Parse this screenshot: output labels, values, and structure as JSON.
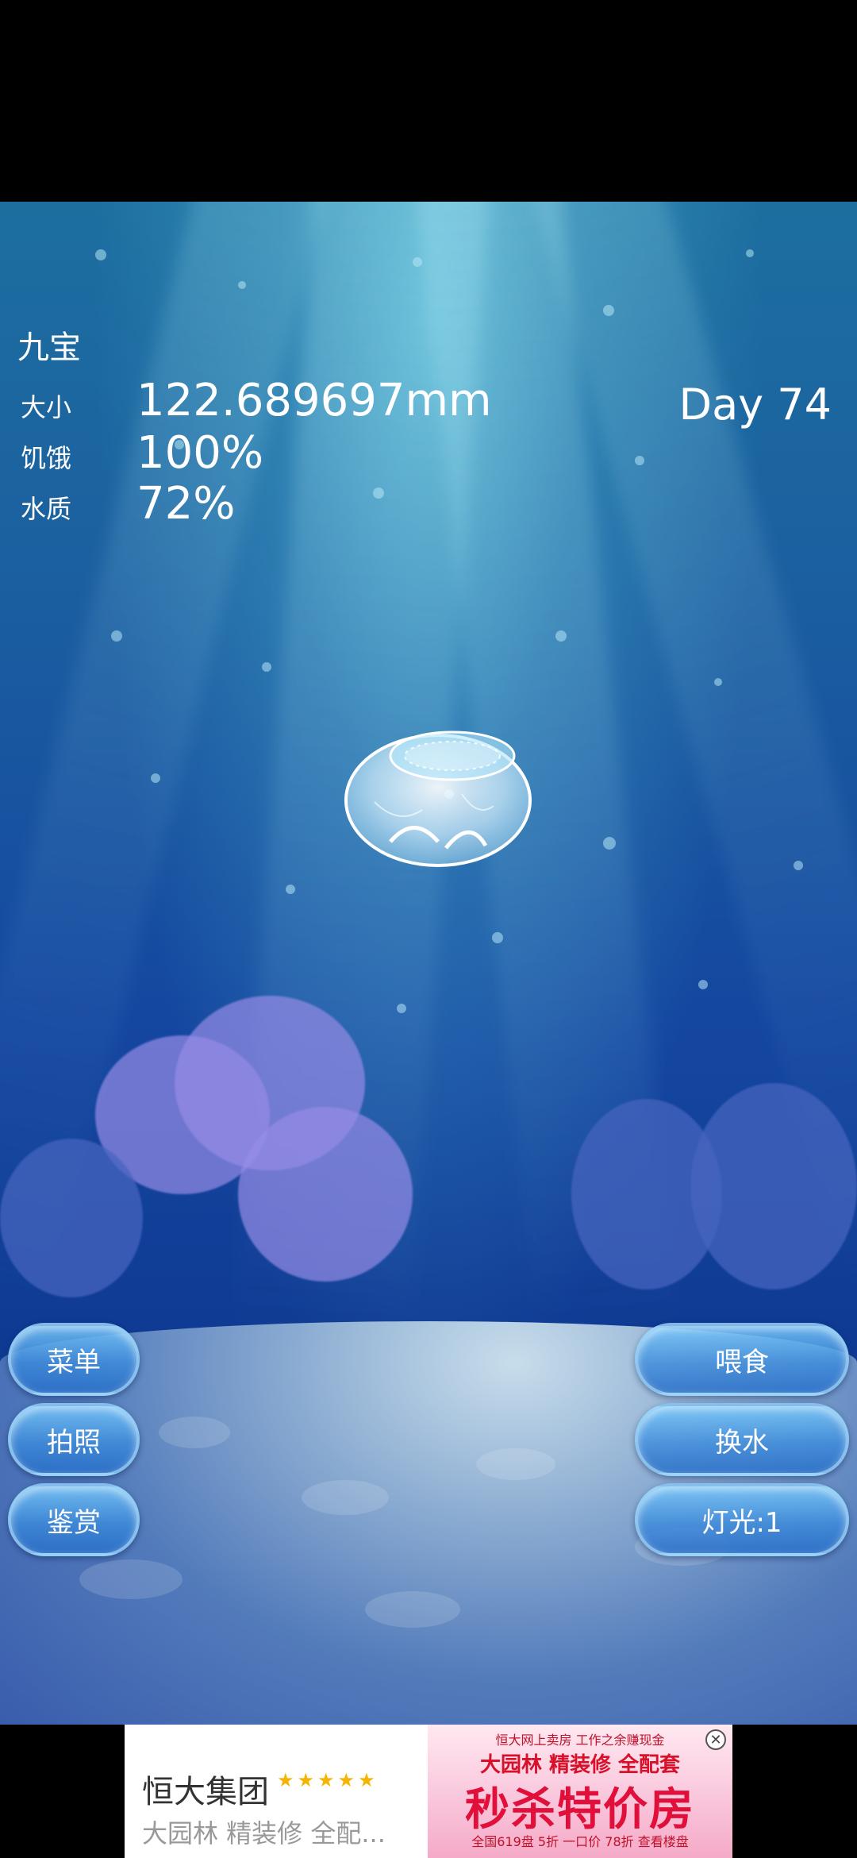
{
  "hud": {
    "pet_name": "九宝",
    "size_label": "大小",
    "size_value": "122.689697mm",
    "hunger_label": "饥饿",
    "hunger_value": "100%",
    "water_label": "水质",
    "water_value": "72%",
    "day": "Day 74"
  },
  "buttons": {
    "menu": "菜单",
    "photo": "拍照",
    "view": "鉴赏",
    "feed": "喂食",
    "change_water": "换水",
    "light": "灯光:1"
  },
  "ad": {
    "brand": "恒大集团",
    "stars": "★★★★★",
    "subtitle": "大园林 精装修 全配...",
    "banner_top": "恒大网上卖房 工作之余赚现金",
    "banner_mid": "大园林 精装修 全配套",
    "banner_big": "秒杀特价房",
    "banner_bottom": "全国619盘 5折 一口价 78折 查看楼盘",
    "close_icon": "close-icon"
  }
}
